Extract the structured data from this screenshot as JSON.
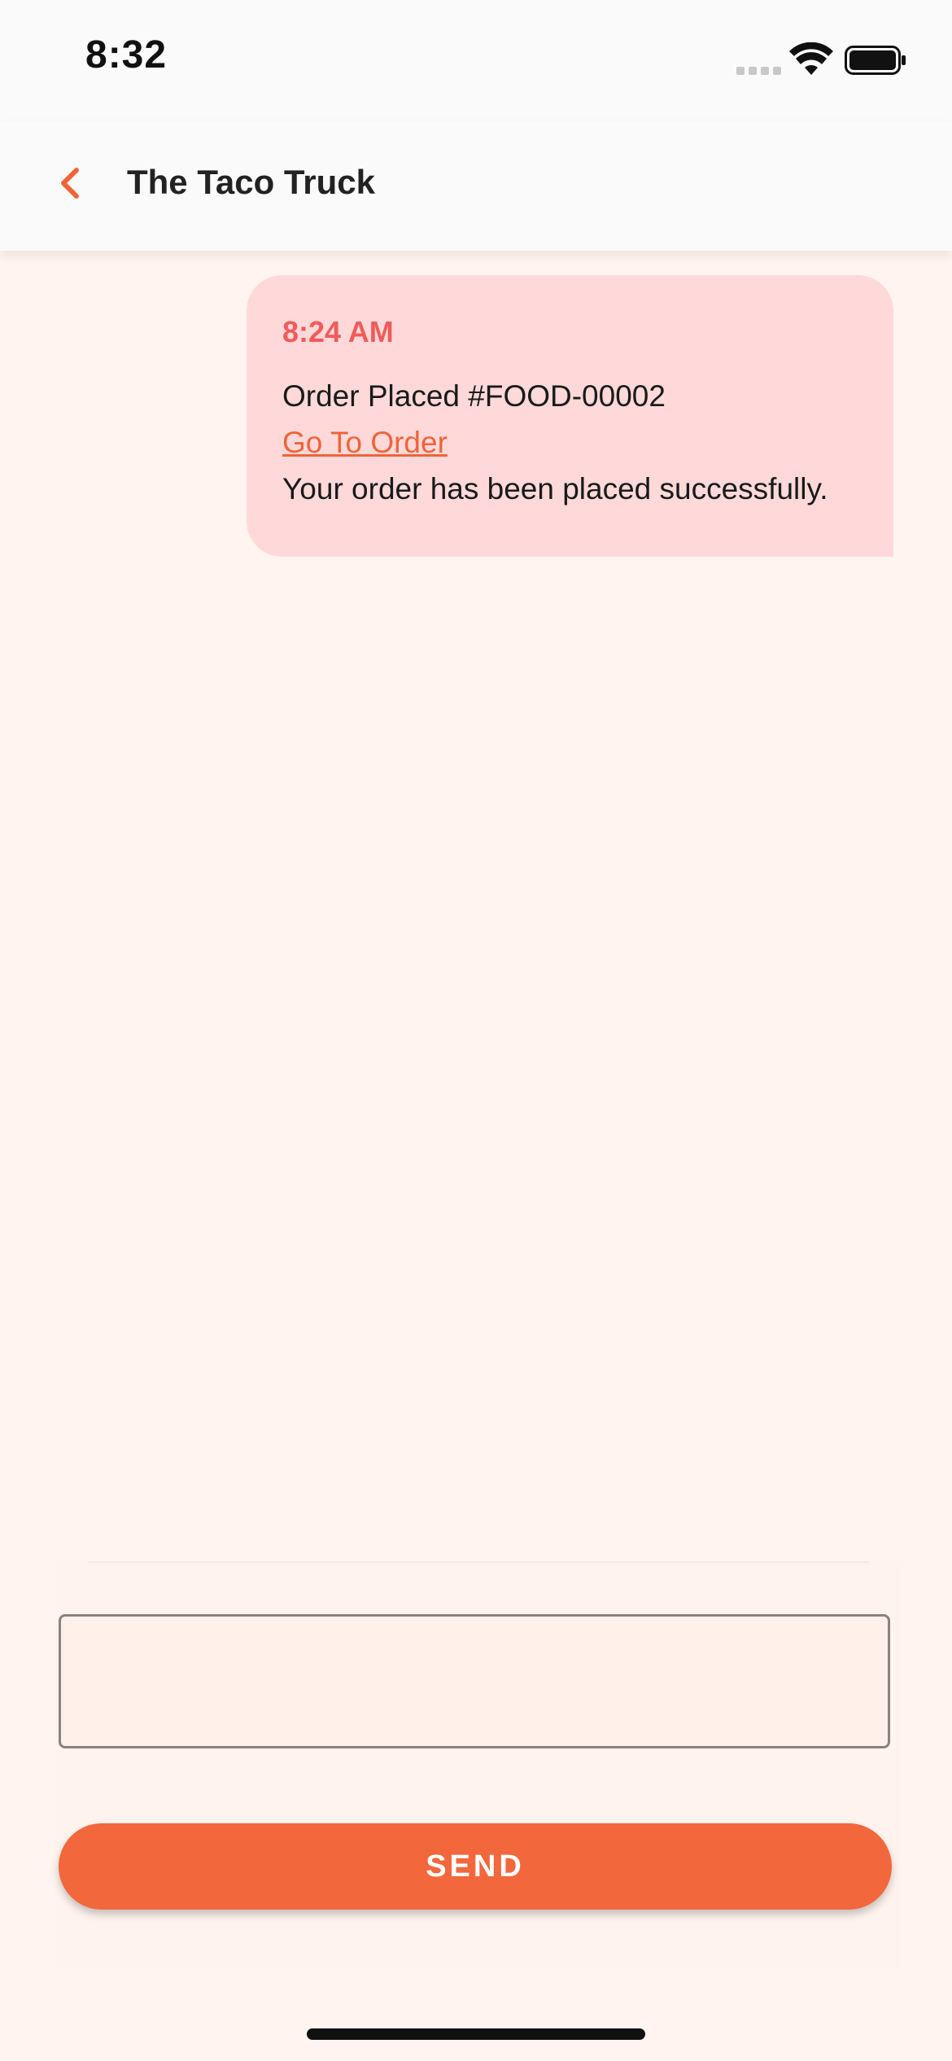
{
  "status_bar": {
    "time": "8:32"
  },
  "app_bar": {
    "title": "The Taco Truck"
  },
  "messages": [
    {
      "time": "8:24 AM",
      "title": "Order Placed #FOOD-00002",
      "link_label": "Go To Order",
      "body": "Your order has been placed successfully."
    }
  ],
  "composer": {
    "input_value": "",
    "send_label": "SEND"
  },
  "colors": {
    "accent": "#f2673c",
    "bubble": "#ffd9d9",
    "bubble_time": "#f15b5b",
    "background": "#fff4ef"
  }
}
